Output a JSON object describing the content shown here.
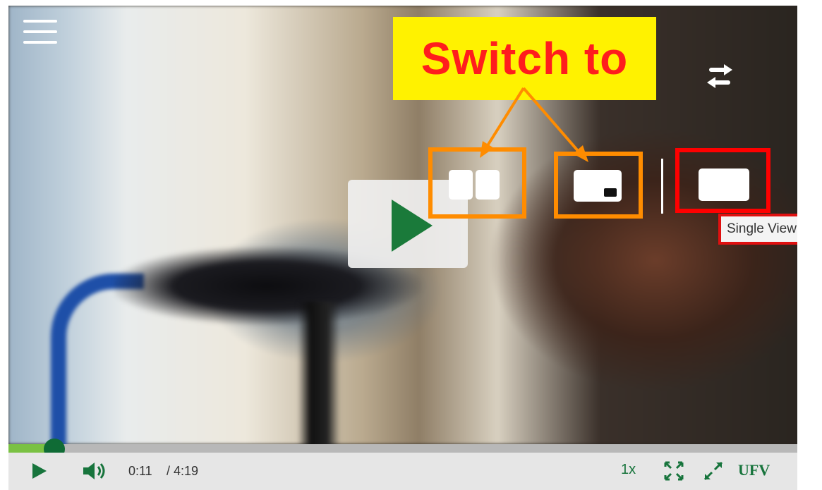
{
  "callout": {
    "text": "Switch to"
  },
  "tooltip": {
    "text": "Single View"
  },
  "video_player": {
    "current_time": "0:11",
    "duration": "/ 4:19",
    "progress_fraction": 0.058,
    "speed_label": "1x",
    "brand_label": "UFV"
  },
  "colors": {
    "player_accent": "#17743c",
    "progress_fill": "#7ac143",
    "callout_background": "#fff200",
    "callout_text": "#ff1d1d",
    "annotation_orange": "#ff8c00",
    "annotation_red": "#ff0000"
  },
  "icons": {
    "menu": "hamburger-menu-icon",
    "swap": "swap-arrows-icon",
    "side_by_side": "side-by-side-view-icon",
    "picture_in_picture": "picture-in-picture-view-icon",
    "single_view": "single-view-icon",
    "play": "play-icon",
    "volume": "volume-icon",
    "fullscreen": "fullscreen-icon",
    "expand": "expand-icon"
  }
}
